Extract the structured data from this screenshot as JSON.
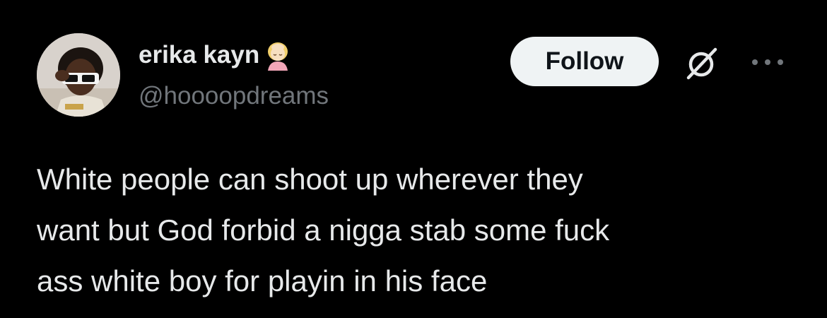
{
  "tweet": {
    "author": {
      "display_name": "erika kayn",
      "handle": "@hoooopdreams",
      "name_emoji": "woman-facepalming-emoji",
      "avatar": "avatar"
    },
    "actions": {
      "follow_label": "Follow",
      "grok_icon": "grok-icon",
      "more_icon": "more-icon"
    },
    "text_lines": [
      "White people can shoot up wherever they",
      "want but God forbid a nigga stab some fuck",
      "ass white boy for playin in his face"
    ]
  },
  "colors": {
    "background": "#000000",
    "primary_text": "#e7e9ea",
    "secondary_text": "#71767b",
    "follow_button_bg": "#eff3f4",
    "follow_button_text": "#0f1419"
  }
}
